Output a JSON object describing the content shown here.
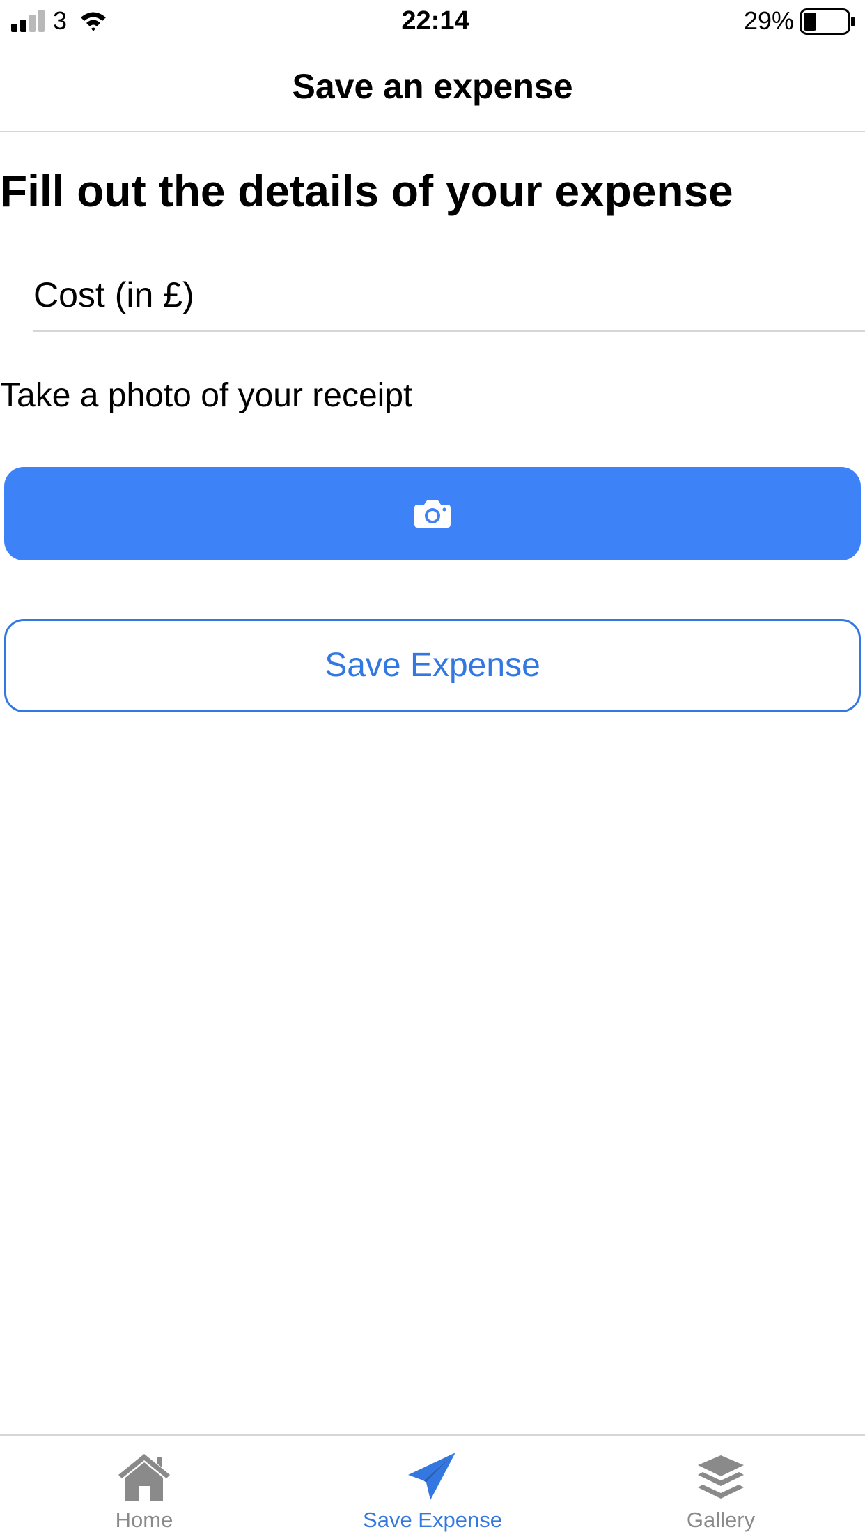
{
  "status_bar": {
    "carrier": "3",
    "time": "22:14",
    "battery_percent": "29%",
    "battery_level": 0.29,
    "icons": [
      "signal-icon",
      "wifi-icon",
      "battery-icon"
    ]
  },
  "header": {
    "title": "Save an expense"
  },
  "form": {
    "heading": "Fill out the details of your expense",
    "cost_placeholder": "Cost (in £)",
    "cost_value": "",
    "photo_label": "Take a photo of your receipt",
    "camera_button_icon": "camera-icon",
    "save_button_label": "Save Expense"
  },
  "tab_bar": {
    "tabs": [
      {
        "label": "Home",
        "icon": "home-icon",
        "active": false
      },
      {
        "label": "Save Expense",
        "icon": "paper-plane-icon",
        "active": true
      },
      {
        "label": "Gallery",
        "icon": "layers-icon",
        "active": false
      }
    ]
  },
  "colors": {
    "accent": "#3278e0",
    "primary_button": "#3e82f7",
    "inactive_tab": "#8a8a8a",
    "divider": "#d6d6d6"
  }
}
